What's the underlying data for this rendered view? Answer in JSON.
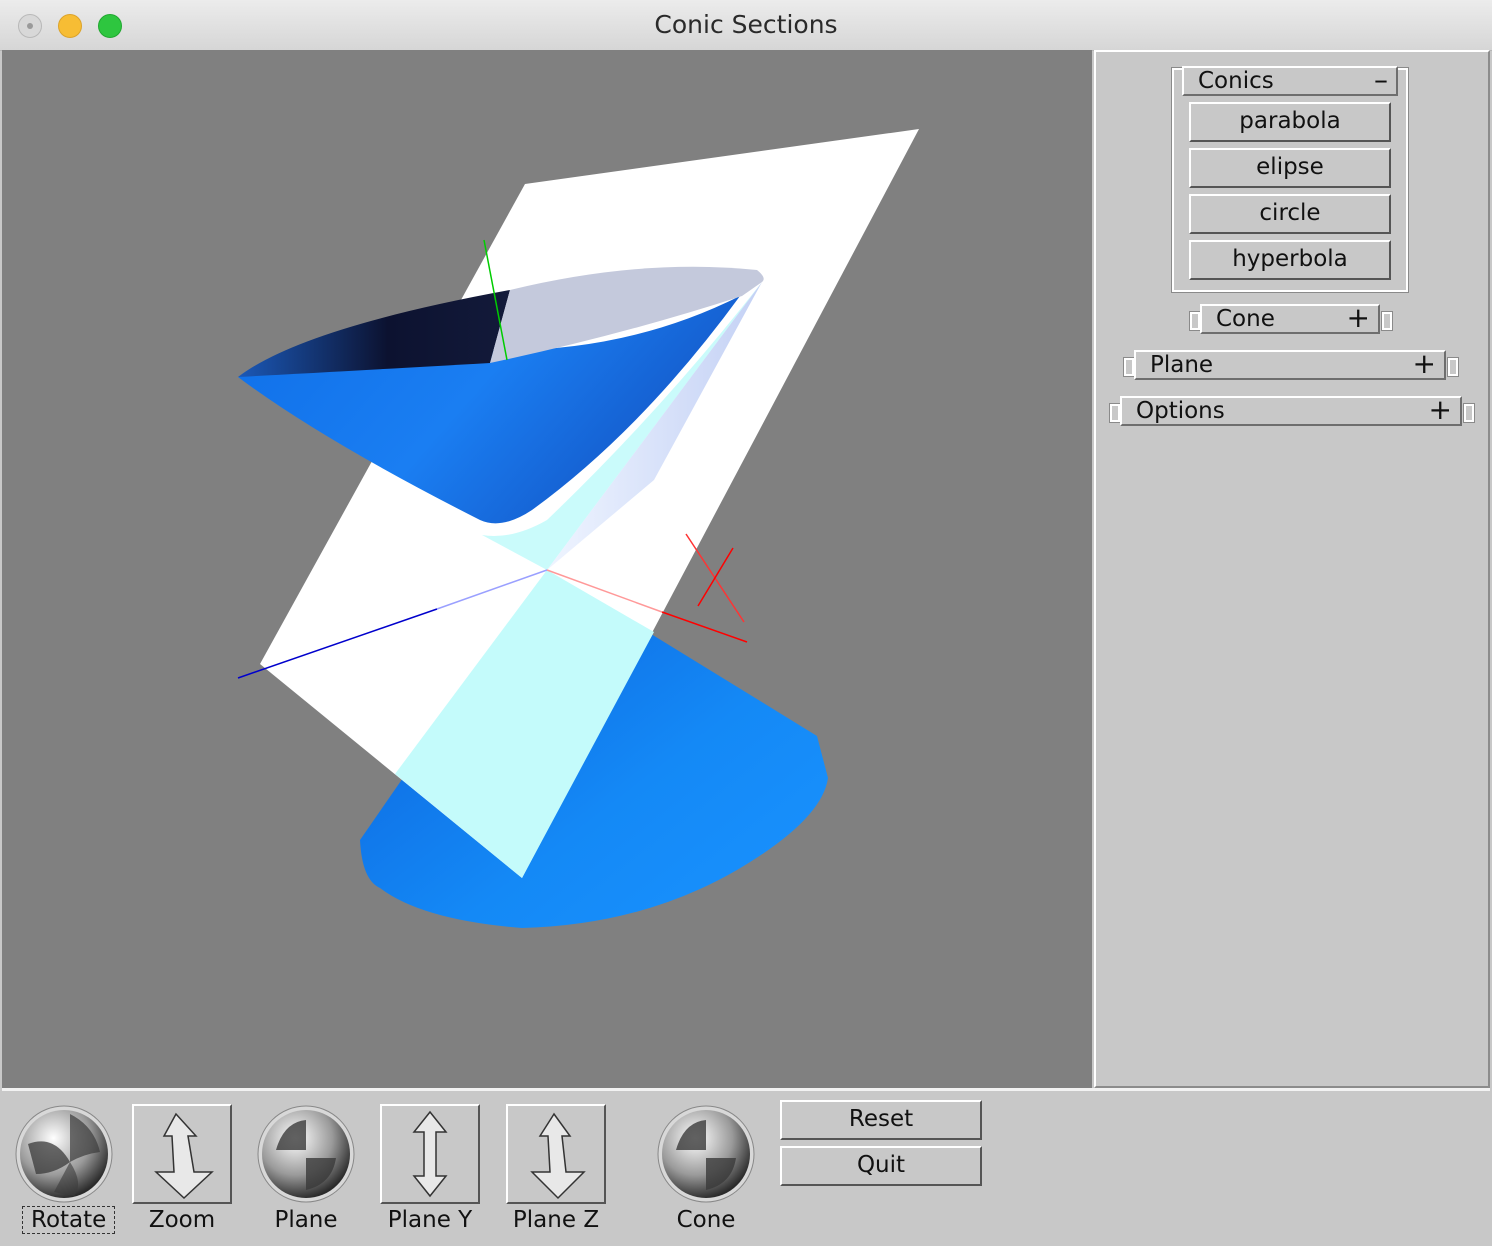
{
  "window": {
    "title": "Conic Sections"
  },
  "side_panel": {
    "conics_rollout": {
      "label": "Conics",
      "toggle": "–",
      "buttons": [
        "parabola",
        "elipse",
        "circle",
        "hyperbola"
      ]
    },
    "cone_rollout": {
      "label": "Cone",
      "toggle": "+"
    },
    "plane_rollout": {
      "label": "Plane",
      "toggle": "+"
    },
    "options_rollout": {
      "label": "Options",
      "toggle": "+"
    }
  },
  "bottom_bar": {
    "controls": [
      "Rotate",
      "Zoom",
      "Plane",
      "Plane Y",
      "Plane Z",
      "Cone"
    ],
    "buttons": {
      "reset": "Reset",
      "quit": "Quit"
    }
  },
  "colors": {
    "viewport_bg": "#808080",
    "cone": "#1a7ef2",
    "plane": "#ffffff",
    "intersection": "#c4fbfb",
    "axis_x": "#ff0000",
    "axis_y": "#00cc00",
    "axis_z": "#0000cc"
  }
}
